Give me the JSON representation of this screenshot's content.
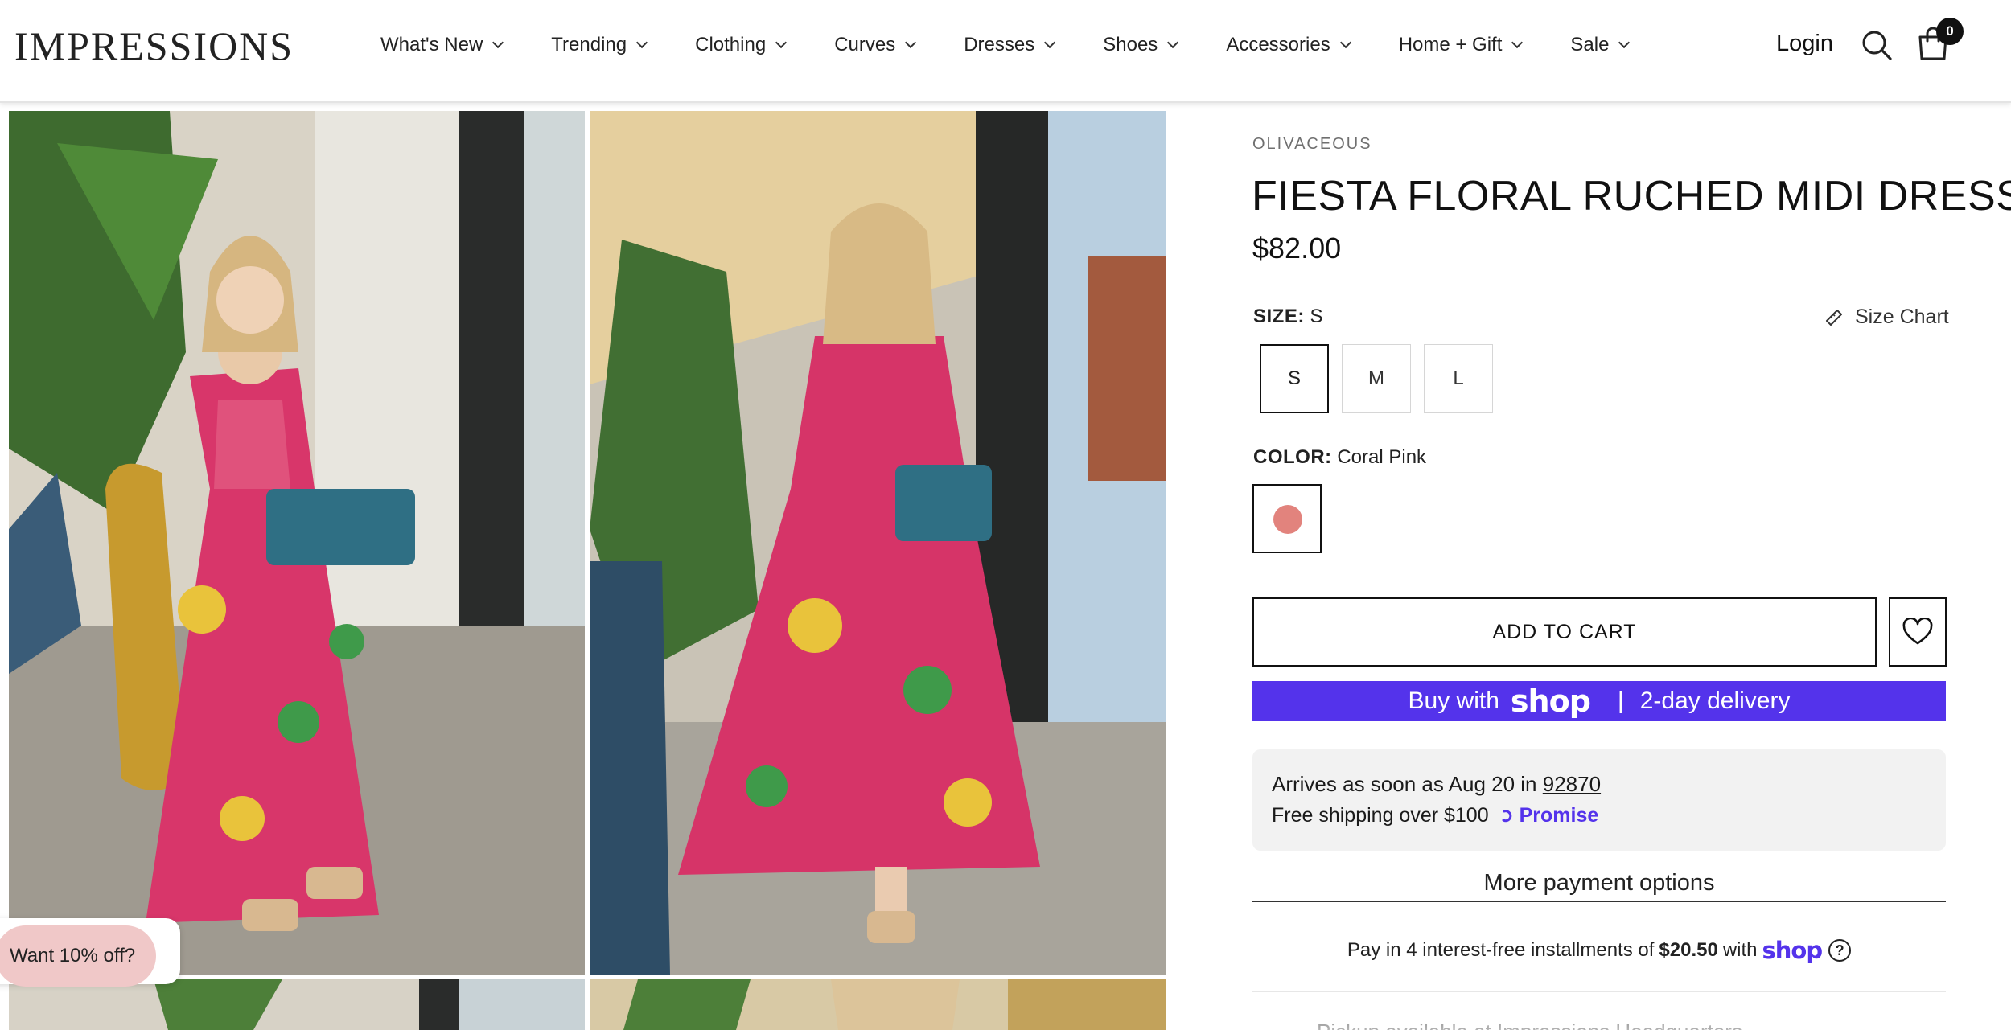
{
  "header": {
    "logo": "IMPRESSIONS",
    "nav": [
      {
        "label": "What's New"
      },
      {
        "label": "Trending"
      },
      {
        "label": "Clothing"
      },
      {
        "label": "Curves"
      },
      {
        "label": "Dresses"
      },
      {
        "label": "Shoes"
      },
      {
        "label": "Accessories"
      },
      {
        "label": "Home + Gift"
      },
      {
        "label": "Sale"
      }
    ],
    "login": "Login",
    "cart_count": "0"
  },
  "promo": {
    "label": "Want 10% off?"
  },
  "product": {
    "brand": "OLIVACEOUS",
    "title": "FIESTA FLORAL RUCHED MIDI DRESS",
    "price": "$82.00",
    "size_label": "SIZE:",
    "size_value": "S",
    "size_chart": "Size Chart",
    "sizes": [
      "S",
      "M",
      "L"
    ],
    "selected_size": "S",
    "color_label": "COLOR:",
    "color_value": "Coral Pink",
    "swatch_color": "#e2837d",
    "add_to_cart": "ADD TO CART",
    "shop_pay": {
      "prefix": "Buy with",
      "logo": "shop",
      "separator": "|",
      "suffix": "2-day delivery",
      "color": "#5433eb"
    },
    "delivery": {
      "arrives_prefix": "Arrives as soon as Aug 20 in",
      "zip": "92870",
      "free_shipping": "Free shipping over $100",
      "promise": "Promise",
      "promise_color": "#5433eb"
    },
    "more_payment": "More payment options",
    "installments": {
      "prefix": "Pay in 4 interest-free installments of",
      "amount": "$20.50",
      "with": "with",
      "logo": "shop",
      "info": "?"
    },
    "cut_off_text": "Pickup available at Impressions Headquarters"
  }
}
